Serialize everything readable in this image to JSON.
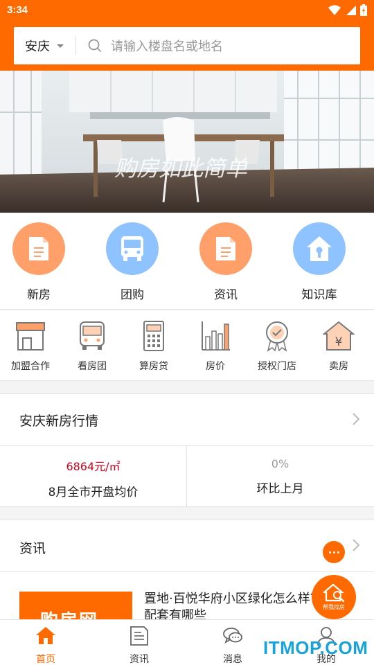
{
  "status_bar": {
    "time": "3:34",
    "icons": [
      "wifi-icon",
      "signal-icon",
      "battery-icon"
    ]
  },
  "header": {
    "city": "安庆",
    "search_placeholder": "请输入楼盘名或地名",
    "color": "#ff6a00"
  },
  "banner": {
    "caption": "购房如此简单",
    "image": "dining-room-photo"
  },
  "categories": [
    {
      "label": "新房",
      "icon": "document-icon",
      "color": "#ffa06a"
    },
    {
      "label": "团购",
      "icon": "bus-icon",
      "color": "#8fc3ff"
    },
    {
      "label": "资讯",
      "icon": "document-icon",
      "color": "#ffa06a"
    },
    {
      "label": "知识库",
      "icon": "house-key-icon",
      "color": "#8fc3ff"
    }
  ],
  "tools": [
    {
      "label": "加盟合作",
      "icon": "storefront-icon"
    },
    {
      "label": "看房团",
      "icon": "bus-icon"
    },
    {
      "label": "算房贷",
      "icon": "calculator-icon"
    },
    {
      "label": "房价",
      "icon": "bar-chart-icon"
    },
    {
      "label": "授权门店",
      "icon": "certified-badge-icon"
    },
    {
      "label": "卖房",
      "icon": "yen-house-icon"
    }
  ],
  "market": {
    "title": "安庆新房行情",
    "stats": [
      {
        "value": "6864元/㎡",
        "label": "8月全市开盘均价",
        "color": "#d0021b"
      },
      {
        "value": "0%",
        "label": "环比上月",
        "color": "#999999"
      }
    ]
  },
  "news": {
    "title": "资讯",
    "item": {
      "thumb_text": "购房网",
      "headline": "置地·百悦华府小区绿化怎么样？配套有哪些"
    }
  },
  "fab": {
    "find_label": "帮我找房"
  },
  "tabbar": [
    {
      "label": "首页",
      "icon": "home-icon",
      "active": true
    },
    {
      "label": "资讯",
      "icon": "news-icon",
      "active": false
    },
    {
      "label": "消息",
      "icon": "chat-icon",
      "active": false
    },
    {
      "label": "我的",
      "icon": "user-icon",
      "active": false
    }
  ],
  "watermark": "ITMOP.COM"
}
